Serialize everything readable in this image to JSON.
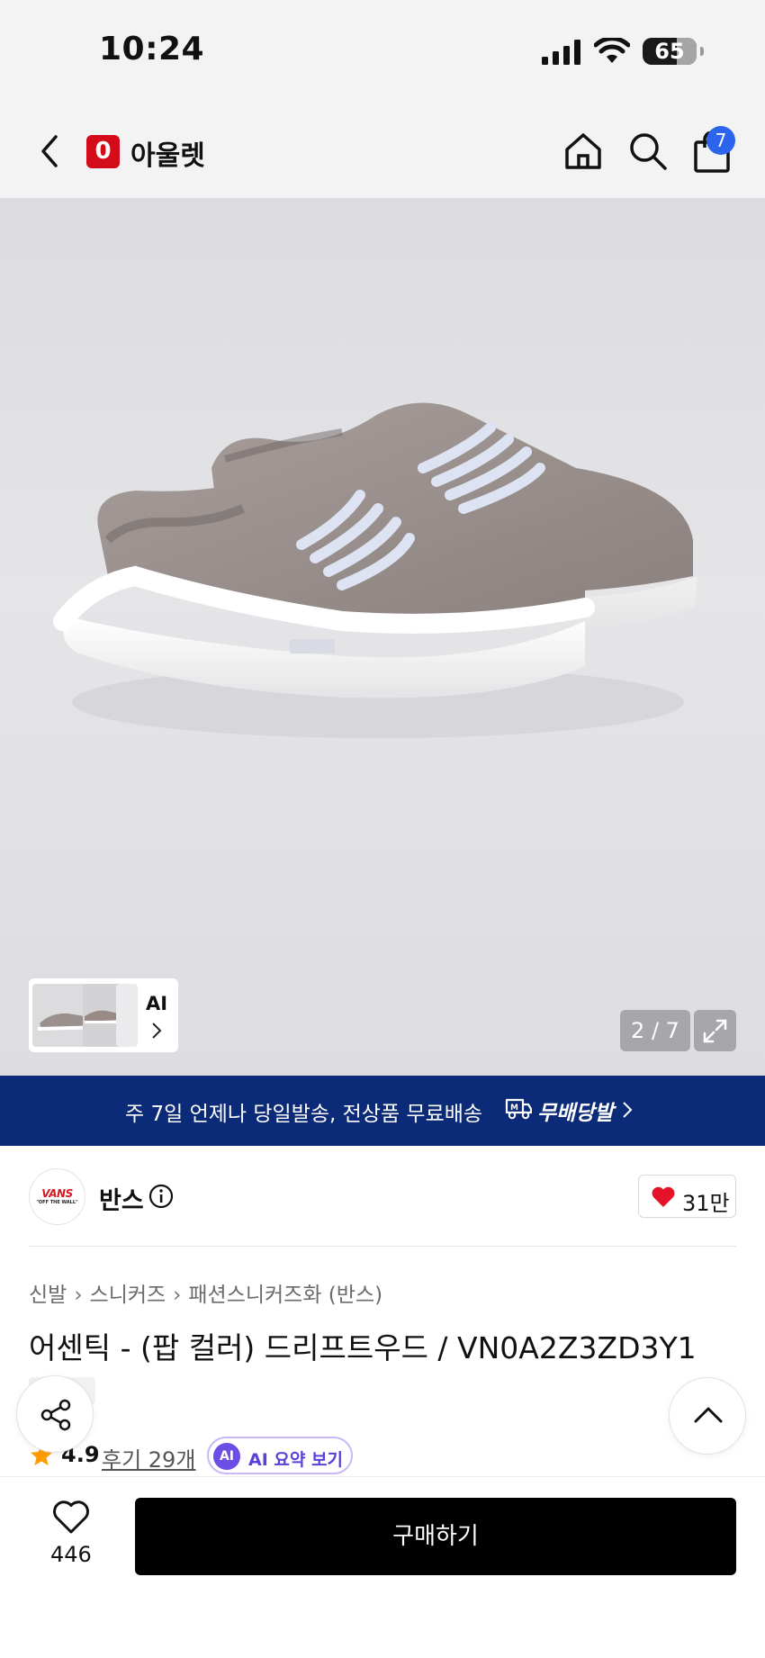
{
  "status_bar": {
    "time": "10:24",
    "battery": "65"
  },
  "header": {
    "app_logo_letter": "0",
    "app_name": "아울렛",
    "cart_badge": "7",
    "icons": [
      "back-arrow-icon",
      "home-icon",
      "search-icon",
      "shopping-bag-icon"
    ]
  },
  "gallery": {
    "thumbnail_label": "AI",
    "counter": "2 / 7",
    "current_index": 2,
    "total": 7
  },
  "shipping_banner": {
    "text": "주 7일 언제나 당일발송, 전상품 무료배송",
    "brand": "무배당발"
  },
  "brand": {
    "name": "반스",
    "logo_text": "VANS",
    "logo_subtext": "\"OFF THE WALL\"",
    "like_count": "31만"
  },
  "breadcrumb": [
    "신발",
    "스니커즈",
    "패션스니커즈화 (반스)"
  ],
  "product": {
    "title": "어센틱 - (팝 컬러) 드리프트우드 / VN0A2Z3ZD3Y1"
  },
  "rating": {
    "score": "4.9",
    "reviews": "후기 29개",
    "ai_badge": "AI",
    "ai_summary": "AI 요약 보기"
  },
  "bottom_bar": {
    "wish_count": "446",
    "buy_label": "구매하기"
  },
  "colors": {
    "brand_red": "#d40c19",
    "banner_navy": "#0b2a77",
    "badge_blue": "#2c64ee",
    "heart_red": "#e5132a",
    "star_orange": "#ff9d00",
    "ai_purple": "#6c4de6"
  }
}
